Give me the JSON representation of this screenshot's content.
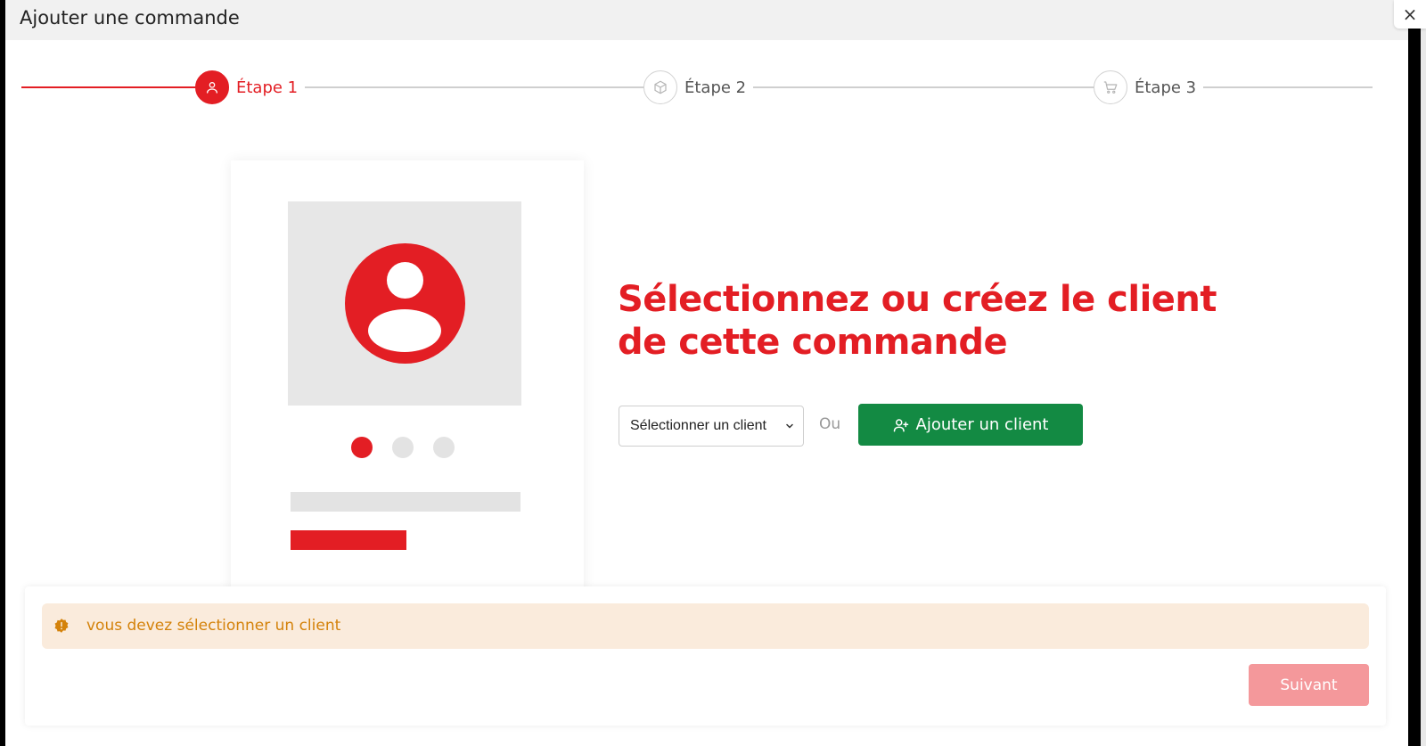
{
  "modal": {
    "title": "Ajouter une commande",
    "close_label": "×"
  },
  "stepper": {
    "steps": [
      {
        "label": "Étape 1",
        "icon": "user-icon",
        "active": true
      },
      {
        "label": "Étape 2",
        "icon": "box-icon",
        "active": false
      },
      {
        "label": "Étape 3",
        "icon": "cart-icon",
        "active": false
      }
    ]
  },
  "illustration": {
    "carousel_active_index": 0,
    "carousel_count": 3
  },
  "main": {
    "heading": "Sélectionnez ou créez le client de cette commande",
    "client_select": {
      "selected": "Sélectionner un client"
    },
    "or_label": "Ou",
    "add_client_label": "Ajouter un client"
  },
  "footer": {
    "alert_text": "vous devez sélectionner un client",
    "next_label": "Suivant"
  },
  "colors": {
    "brand_red": "#e31e24",
    "success_green": "#138a43",
    "warning_bg": "#faebdc",
    "warning_text": "#d4820a",
    "disabled_button": "#f4989b"
  }
}
